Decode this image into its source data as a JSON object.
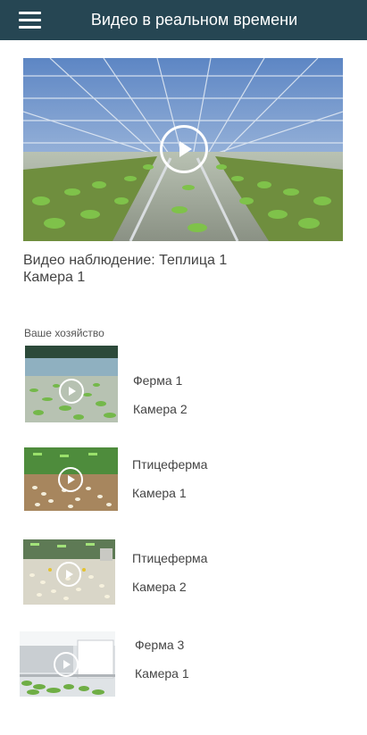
{
  "header": {
    "title": "Видео в реальном времени",
    "menu_icon": "hamburger-menu-icon"
  },
  "main_video": {
    "title_line1": "Видео наблюдение: Теплица 1",
    "title_line2": "Камера 1",
    "play_icon": "play-circle-icon"
  },
  "section": {
    "label": "Ваше хозяйство"
  },
  "items": [
    {
      "name": "Ферма 1",
      "camera": "Камера 2",
      "scene": "greenhouse"
    },
    {
      "name": "Птицеферма",
      "camera": "Камера 1",
      "scene": "poultry-green"
    },
    {
      "name": "Птицеферма",
      "camera": "Камера 2",
      "scene": "poultry-white"
    },
    {
      "name": "Ферма 3",
      "camera": "Камера 1",
      "scene": "greenhouse-indoor"
    }
  ],
  "colors": {
    "appbar": "#264653",
    "text": "#444444"
  }
}
